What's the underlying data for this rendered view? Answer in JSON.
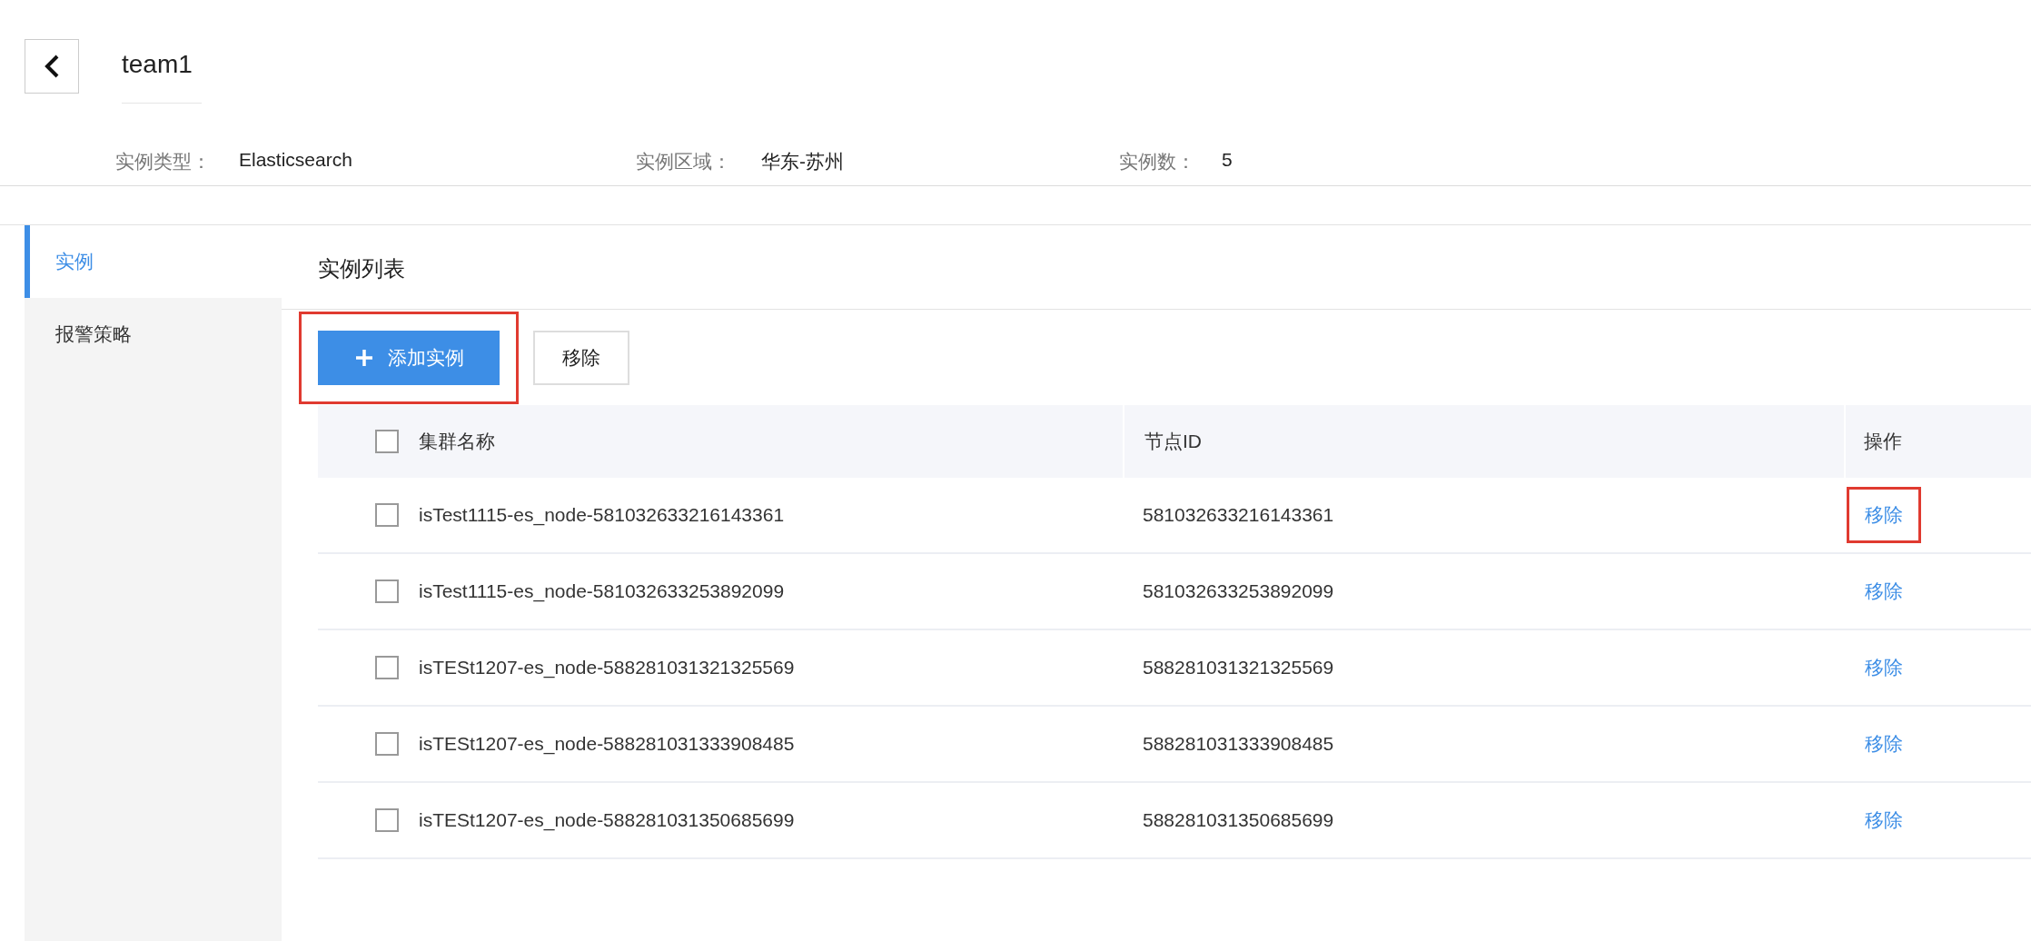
{
  "header": {
    "title": "team1"
  },
  "info": [
    {
      "label": "实例类型：",
      "value": "Elasticsearch"
    },
    {
      "label": "实例区域：",
      "value": "华东-苏州"
    },
    {
      "label": "实例数：",
      "value": "5"
    }
  ],
  "sidebar": {
    "items": [
      {
        "label": "实例",
        "selected": true
      },
      {
        "label": "报警策略",
        "selected": false
      }
    ]
  },
  "panel": {
    "title": "实例列表",
    "toolbar": [
      {
        "label": "添加实例",
        "kind": "primary",
        "highlighted": true
      },
      {
        "label": "移除",
        "kind": "default",
        "highlighted": false
      }
    ]
  },
  "table": {
    "columns": [
      "集群名称",
      "节点ID",
      "操作"
    ],
    "header_checked": false,
    "rows": [
      {
        "checked": false,
        "name": "isTest1115-es_node-581032633216143361",
        "node_id": "581032633216143361",
        "action": "移除",
        "highlighted": true
      },
      {
        "checked": false,
        "name": "isTest1115-es_node-581032633253892099",
        "node_id": "581032633253892099",
        "action": "移除",
        "highlighted": false
      },
      {
        "checked": false,
        "name": "isTESt1207-es_node-588281031321325569",
        "node_id": "588281031321325569",
        "action": "移除",
        "highlighted": false
      },
      {
        "checked": false,
        "name": "isTESt1207-es_node-588281031333908485",
        "node_id": "588281031333908485",
        "action": "移除",
        "highlighted": false
      },
      {
        "checked": false,
        "name": "isTESt1207-es_node-588281031350685699",
        "node_id": "588281031350685699",
        "action": "移除",
        "highlighted": false
      }
    ]
  }
}
